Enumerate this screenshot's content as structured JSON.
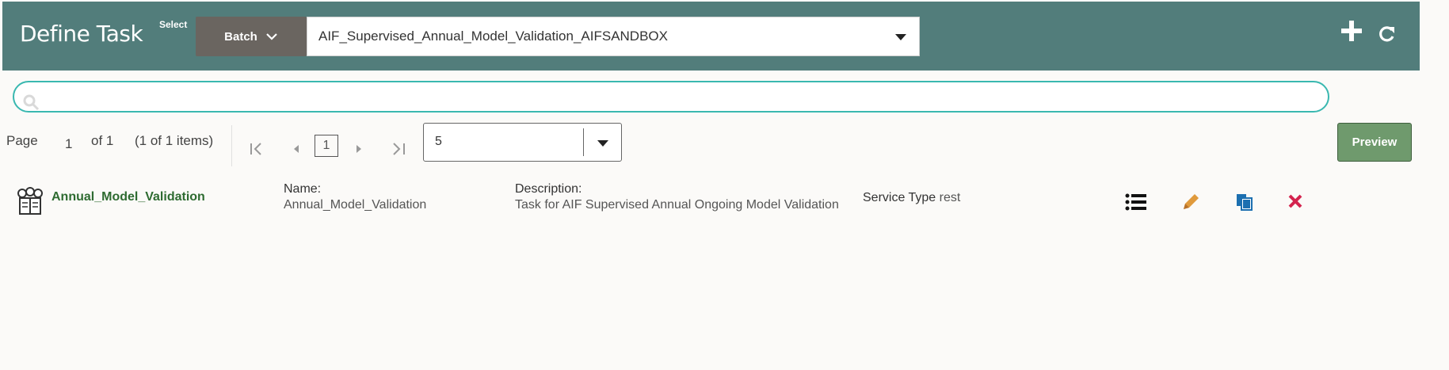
{
  "header": {
    "title": "Define Task",
    "select_label": "Select",
    "batch_button_label": "Batch",
    "batch_selected": "AIF_Supervised_Annual_Model_Validation_AIFSANDBOX",
    "add_icon": "plus-icon",
    "refresh_icon": "refresh-icon"
  },
  "search": {
    "placeholder": "",
    "icon": "search-icon"
  },
  "pagination": {
    "page_label": "Page",
    "current_page": "1",
    "of_text": "of 1",
    "items_text": "(1 of 1 items)",
    "page_box": "1",
    "page_size": "5"
  },
  "preview_label": "Preview",
  "tasks": [
    {
      "name_link": "Annual_Model_Validation",
      "name_label": "Name:",
      "name_value": "Annual_Model_Validation",
      "description_label": "Description:",
      "description_value": "Task for AIF Supervised Annual Ongoing Model Validation",
      "service_type_label": "Service Type",
      "service_type_value": "rest"
    }
  ],
  "colors": {
    "header_bg": "#527d7b",
    "batch_btn_bg": "#6a6560",
    "search_border": "#3ab8b0",
    "preview_bg": "#6f9a6d",
    "task_link": "#2e6b31",
    "edit_icon": "#e09a3c",
    "copy_icon": "#1c6fb0",
    "delete_icon": "#d4234e"
  }
}
